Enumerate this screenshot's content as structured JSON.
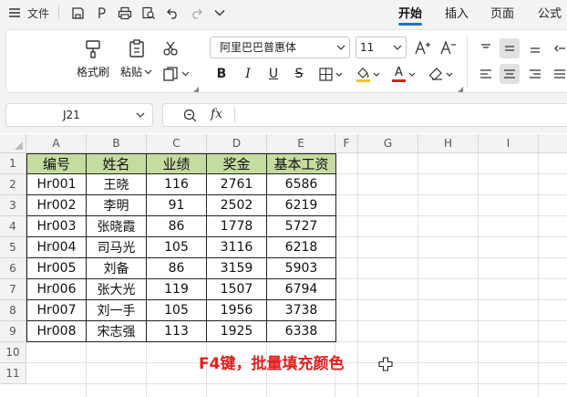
{
  "titlebar": {
    "file_label": "文件",
    "menu_tabs": [
      {
        "label": "开始",
        "active": true
      },
      {
        "label": "插入",
        "active": false
      },
      {
        "label": "页面",
        "active": false
      },
      {
        "label": "公式",
        "active": false
      }
    ]
  },
  "ribbon": {
    "format_painter_label": "格式刷",
    "paste_label": "粘贴",
    "font_name": "阿里巴巴普惠体",
    "font_size": "11",
    "underline_glyph": "U",
    "strike_glyph": "S",
    "font_color_glyph": "A",
    "highlight_color": "#f5c518",
    "font_color": "#e0201e"
  },
  "formula_bar": {
    "cell_ref": "J21",
    "fx_label": "fx",
    "formula": ""
  },
  "sheet": {
    "columns": [
      "A",
      "B",
      "C",
      "D",
      "E",
      "F",
      "G",
      "H",
      "I"
    ],
    "rows": [
      "1",
      "2",
      "3",
      "4",
      "5",
      "6",
      "7",
      "8",
      "9",
      "10",
      "11"
    ],
    "table": {
      "headers": [
        "编号",
        "姓名",
        "业绩",
        "奖金",
        "基本工资"
      ],
      "rows": [
        [
          "Hr001",
          "王晓",
          "116",
          "2761",
          "6586"
        ],
        [
          "Hr002",
          "李明",
          "91",
          "2502",
          "6219"
        ],
        [
          "Hr003",
          "张晓霞",
          "86",
          "1778",
          "5727"
        ],
        [
          "Hr004",
          "司马光",
          "105",
          "3116",
          "6218"
        ],
        [
          "Hr005",
          "刘备",
          "86",
          "3159",
          "5903"
        ],
        [
          "Hr006",
          "张大光",
          "119",
          "1507",
          "6794"
        ],
        [
          "Hr007",
          "刘一手",
          "105",
          "1956",
          "3738"
        ],
        [
          "Hr008",
          "宋志强",
          "113",
          "1925",
          "6338"
        ]
      ]
    },
    "header_fill": "#c6dba0",
    "annotation": "F4键，批量填充颜色",
    "annotation_color": "#e0201e"
  }
}
